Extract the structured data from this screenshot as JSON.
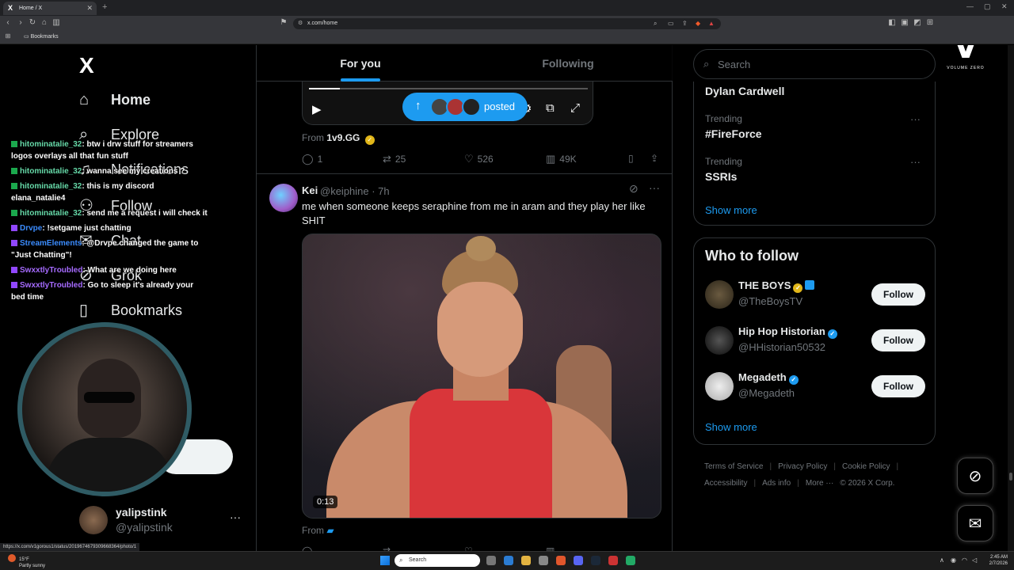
{
  "browser": {
    "tab_title": "Home / X",
    "url": "x.com/home",
    "bookmarks_label": "Bookmarks",
    "status_url": "https://x.com/v1gorous1/status/2019674679309668364/photo/1"
  },
  "nav": {
    "logo": "X",
    "items": [
      {
        "label": "Home",
        "icon": "home-icon"
      },
      {
        "label": "Explore",
        "icon": "search-icon"
      },
      {
        "label": "Notifications",
        "icon": "bell-icon"
      },
      {
        "label": "Follow",
        "icon": "person-add-icon"
      },
      {
        "label": "Chat",
        "icon": "chat-icon"
      },
      {
        "label": "Grok",
        "icon": "grok-icon"
      },
      {
        "label": "Bookmarks",
        "icon": "bookmark-icon"
      }
    ],
    "account": {
      "name": "yalipstink",
      "handle": "@yalipstink",
      "more": "···"
    }
  },
  "stream_chat": [
    {
      "user": "hitominatalie_32",
      "text": ": btw i drw stuff for streamers logos overlays all that fun stuff",
      "color": "green"
    },
    {
      "user": "hitominatalie_32",
      "text": ": wanna see my creations ?",
      "color": "green"
    },
    {
      "user": "hitominatalie_32",
      "text": ": this is my discord elana_natalie4",
      "color": "green"
    },
    {
      "user": "hitominatalie_32",
      "text": ": send me a request i will check it",
      "color": "green"
    },
    {
      "user": "Drvpe",
      "text": ": !setgame just chatting",
      "color": "blue"
    },
    {
      "user": "StreamElements",
      "text": ": @Drvpe changed the game to \"Just Chatting\"!",
      "color": "blue"
    },
    {
      "user": "SwxxtlyTroubled",
      "text": ": What are we doing here",
      "color": "purple"
    },
    {
      "user": "SwxxtlyTroubled",
      "text": ": Go to sleep it's already your bed time",
      "color": "purple"
    }
  ],
  "feed": {
    "tabs": [
      "For you",
      "Following"
    ],
    "active_tab": "For you",
    "post1": {
      "video_progress": 0.11,
      "posted_label": "posted",
      "from_label": "From",
      "from_source": "1v9.GG",
      "replies": "1",
      "reposts": "25",
      "likes": "526",
      "views": "49K"
    },
    "post2": {
      "name": "Kei",
      "handle": "@keiphine · 7h",
      "text": "me when someone keeps seraphine from me in aram and they play her like SHIT",
      "duration": "0:13",
      "from_label": "From"
    }
  },
  "sidebar": {
    "search_placeholder": "Search",
    "trends": [
      {
        "category": "",
        "name": "Dylan Cardwell"
      },
      {
        "category": "Trending",
        "name": "#FireForce"
      },
      {
        "category": "Trending",
        "name": "SSRIs"
      }
    ],
    "show_more": "Show more",
    "who_to_follow_title": "Who to follow",
    "who_to_follow": [
      {
        "name": "THE BOYS",
        "handle": "@TheBoysTV",
        "button": "Follow"
      },
      {
        "name": "Hip Hop Historian",
        "handle": "@HHistorian50532",
        "button": "Follow"
      },
      {
        "name": "Megadeth",
        "handle": "@Megadeth",
        "button": "Follow"
      }
    ],
    "footer_links": [
      "Terms of Service",
      "Privacy Policy",
      "Cookie Policy",
      "Accessibility",
      "Ads info",
      "More ···",
      "© 2026 X Corp."
    ],
    "watermark": "VOLUME ZERO"
  },
  "taskbar": {
    "weather_temp": "15°F",
    "weather_desc": "Partly sunny",
    "search_placeholder": "Search",
    "time": "2:45 AM",
    "date": "2/7/2026"
  }
}
